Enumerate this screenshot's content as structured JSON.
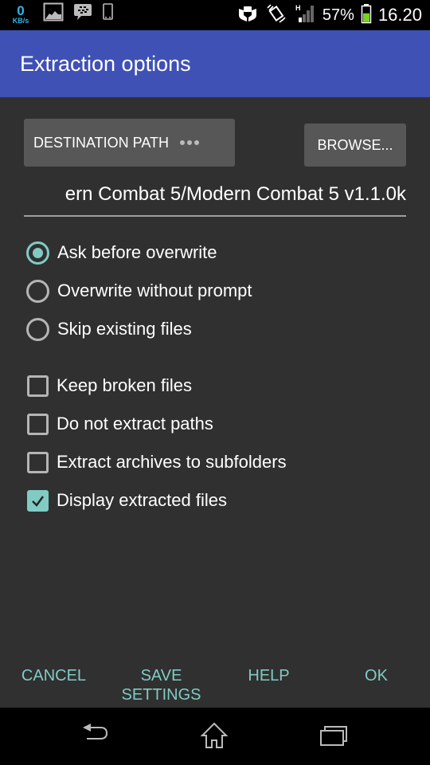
{
  "status_bar": {
    "net_speed_value": "0",
    "net_speed_unit": "KB/s",
    "left_icons": [
      "gallery-notification-icon",
      "bbm-notification-icon",
      "phone-notification-icon"
    ],
    "right_icons": [
      "stamina-mode-icon",
      "vibrate-icon",
      "hspa-signal-icon"
    ],
    "network_type": "H",
    "battery_percent": "57%",
    "battery_level": 0.57,
    "time": "16.20",
    "accent_color": "#33b5e5"
  },
  "app_bar": {
    "title": "Extraction options",
    "color": "#3f51b5"
  },
  "destination": {
    "button_label": "DESTINATION PATH",
    "browse_label": "BROWSE...",
    "path_value": "ern Combat 5/Modern Combat 5 v1.1.0k"
  },
  "overwrite_mode": {
    "options": [
      {
        "label": "Ask before overwrite",
        "selected": true
      },
      {
        "label": "Overwrite without prompt",
        "selected": false
      },
      {
        "label": "Skip existing files",
        "selected": false
      }
    ]
  },
  "checkboxes": [
    {
      "label": "Keep broken files",
      "checked": false
    },
    {
      "label": "Do not extract paths",
      "checked": false
    },
    {
      "label": "Extract archives to subfolders",
      "checked": false
    },
    {
      "label": "Display extracted files",
      "checked": true
    }
  ],
  "actions": {
    "cancel": "CANCEL",
    "save_line1": "SAVE",
    "save_line2": "SETTINGS",
    "help": "HELP",
    "ok": "OK",
    "color": "#80cbc4"
  },
  "nav_bar": {
    "icons": [
      "back-icon",
      "home-icon",
      "recent-apps-icon"
    ]
  }
}
